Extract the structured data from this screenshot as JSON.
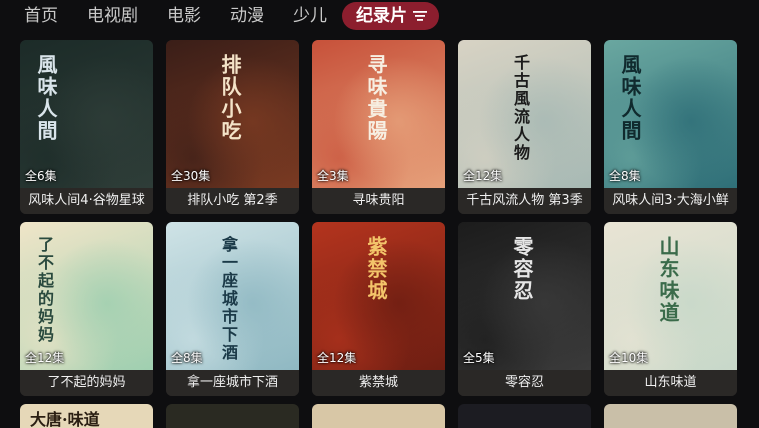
{
  "nav": {
    "tabs": [
      "首页",
      "电视剧",
      "电影",
      "动漫",
      "少儿"
    ],
    "active": "纪录片",
    "filter_icon": "filter-icon",
    "accent": "#8c1e2e"
  },
  "cards": [
    {
      "title": "风味人间4·谷物星球",
      "episodes": "全6集",
      "poster_text": "風味人間",
      "bg": "#1c2b28",
      "bg2": "#2e3d38",
      "ink": "#d9e4ea"
    },
    {
      "title": "排队小吃 第2季",
      "episodes": "全30集",
      "poster_text": "排队小吃",
      "bg": "#3a1e18",
      "bg2": "#7a3a22",
      "ink": "#f4e3c8"
    },
    {
      "title": "寻味贵阳",
      "episodes": "全3集",
      "poster_text": "寻味貴陽",
      "bg": "#c7513a",
      "bg2": "#e6a07a",
      "ink": "#f7efe2"
    },
    {
      "title": "千古风流人物 第3季",
      "episodes": "全12集",
      "poster_text": "千古風流人物",
      "bg": "#d8d3c4",
      "bg2": "#a7b9b4",
      "ink": "#1b1b1b"
    },
    {
      "title": "风味人间3·大海小鲜",
      "episodes": "全8集",
      "poster_text": "風味人間",
      "bg": "#6aa7a0",
      "bg2": "#2f6f78",
      "ink": "#102a2e"
    },
    {
      "title": "了不起的妈妈",
      "episodes": "全12集",
      "poster_text": "了不起的妈妈",
      "bg": "#f0e5c8",
      "bg2": "#9fcfb0",
      "ink": "#2a4a3e"
    },
    {
      "title": "拿一座城市下酒",
      "episodes": "全8集",
      "poster_text": "拿一座城市下酒",
      "bg": "#cfe3e6",
      "bg2": "#8fb8c2",
      "ink": "#1b3a48"
    },
    {
      "title": "紫禁城",
      "episodes": "全12集",
      "poster_text": "紫禁城",
      "bg": "#b4341e",
      "bg2": "#6e1e12",
      "ink": "#f3c46a"
    },
    {
      "title": "零容忍",
      "episodes": "全5集",
      "poster_text": "零容忍",
      "bg": "#1c1c1c",
      "bg2": "#3a3a3a",
      "ink": "#e6e6e6"
    },
    {
      "title": "山东味道",
      "episodes": "全10集",
      "poster_text": "山东味道",
      "bg": "#e9e4d4",
      "bg2": "#c7d8c9",
      "ink": "#3a6b4a"
    }
  ],
  "row3": [
    {
      "poster_text": "大唐·味道",
      "bg": "#e6d8b8"
    },
    {
      "poster_text": "",
      "bg": "#2a2a22"
    },
    {
      "poster_text": "",
      "bg": "#d8c7a6"
    },
    {
      "poster_text": "",
      "bg": "#1c1c22"
    },
    {
      "poster_text": "",
      "bg": "#c9bfa8"
    }
  ]
}
